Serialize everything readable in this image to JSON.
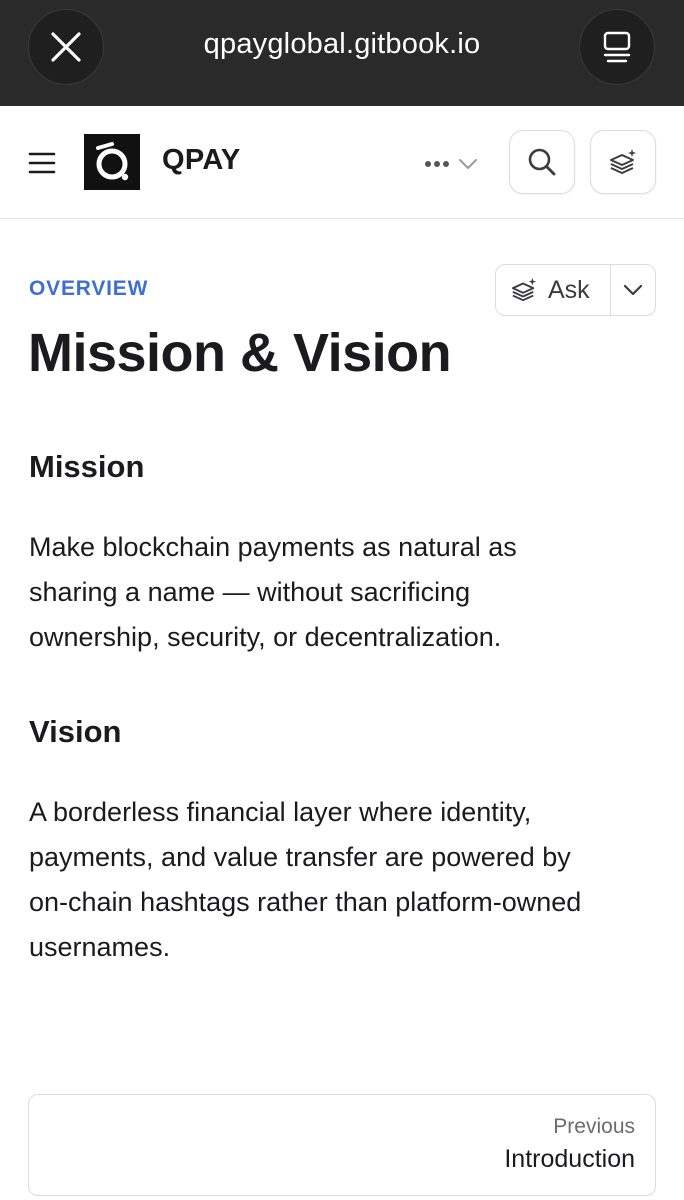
{
  "browser": {
    "url": "qpayglobal.gitbook.io",
    "close_icon": "close-icon",
    "reader_icon": "reader-mode-icon"
  },
  "header": {
    "brand": "QPAY",
    "menu_icon": "hamburger-icon",
    "more_icon": "ellipsis-icon",
    "search_icon": "search-icon",
    "ai_icon": "ai-sparkle-icon"
  },
  "page": {
    "breadcrumb": "OVERVIEW",
    "title": "Mission & Vision",
    "ask_label": "Ask",
    "sections": [
      {
        "heading": "Mission",
        "lines": [
          "Make blockchain payments as natural as",
          "sharing a name — without sacrificing",
          "ownership, security, or decentralization."
        ]
      },
      {
        "heading": "Vision",
        "lines": [
          "A borderless financial layer where identity,",
          "payments, and value transfer are powered by",
          "on-chain hashtags rather than platform-owned",
          "usernames."
        ]
      }
    ]
  },
  "pagination": {
    "previous_label": "Previous",
    "previous_title": "Introduction"
  },
  "colors": {
    "accent": "#3f6fd1",
    "browser_bar": "#2a2a2a",
    "text": "#1b1b1f"
  }
}
